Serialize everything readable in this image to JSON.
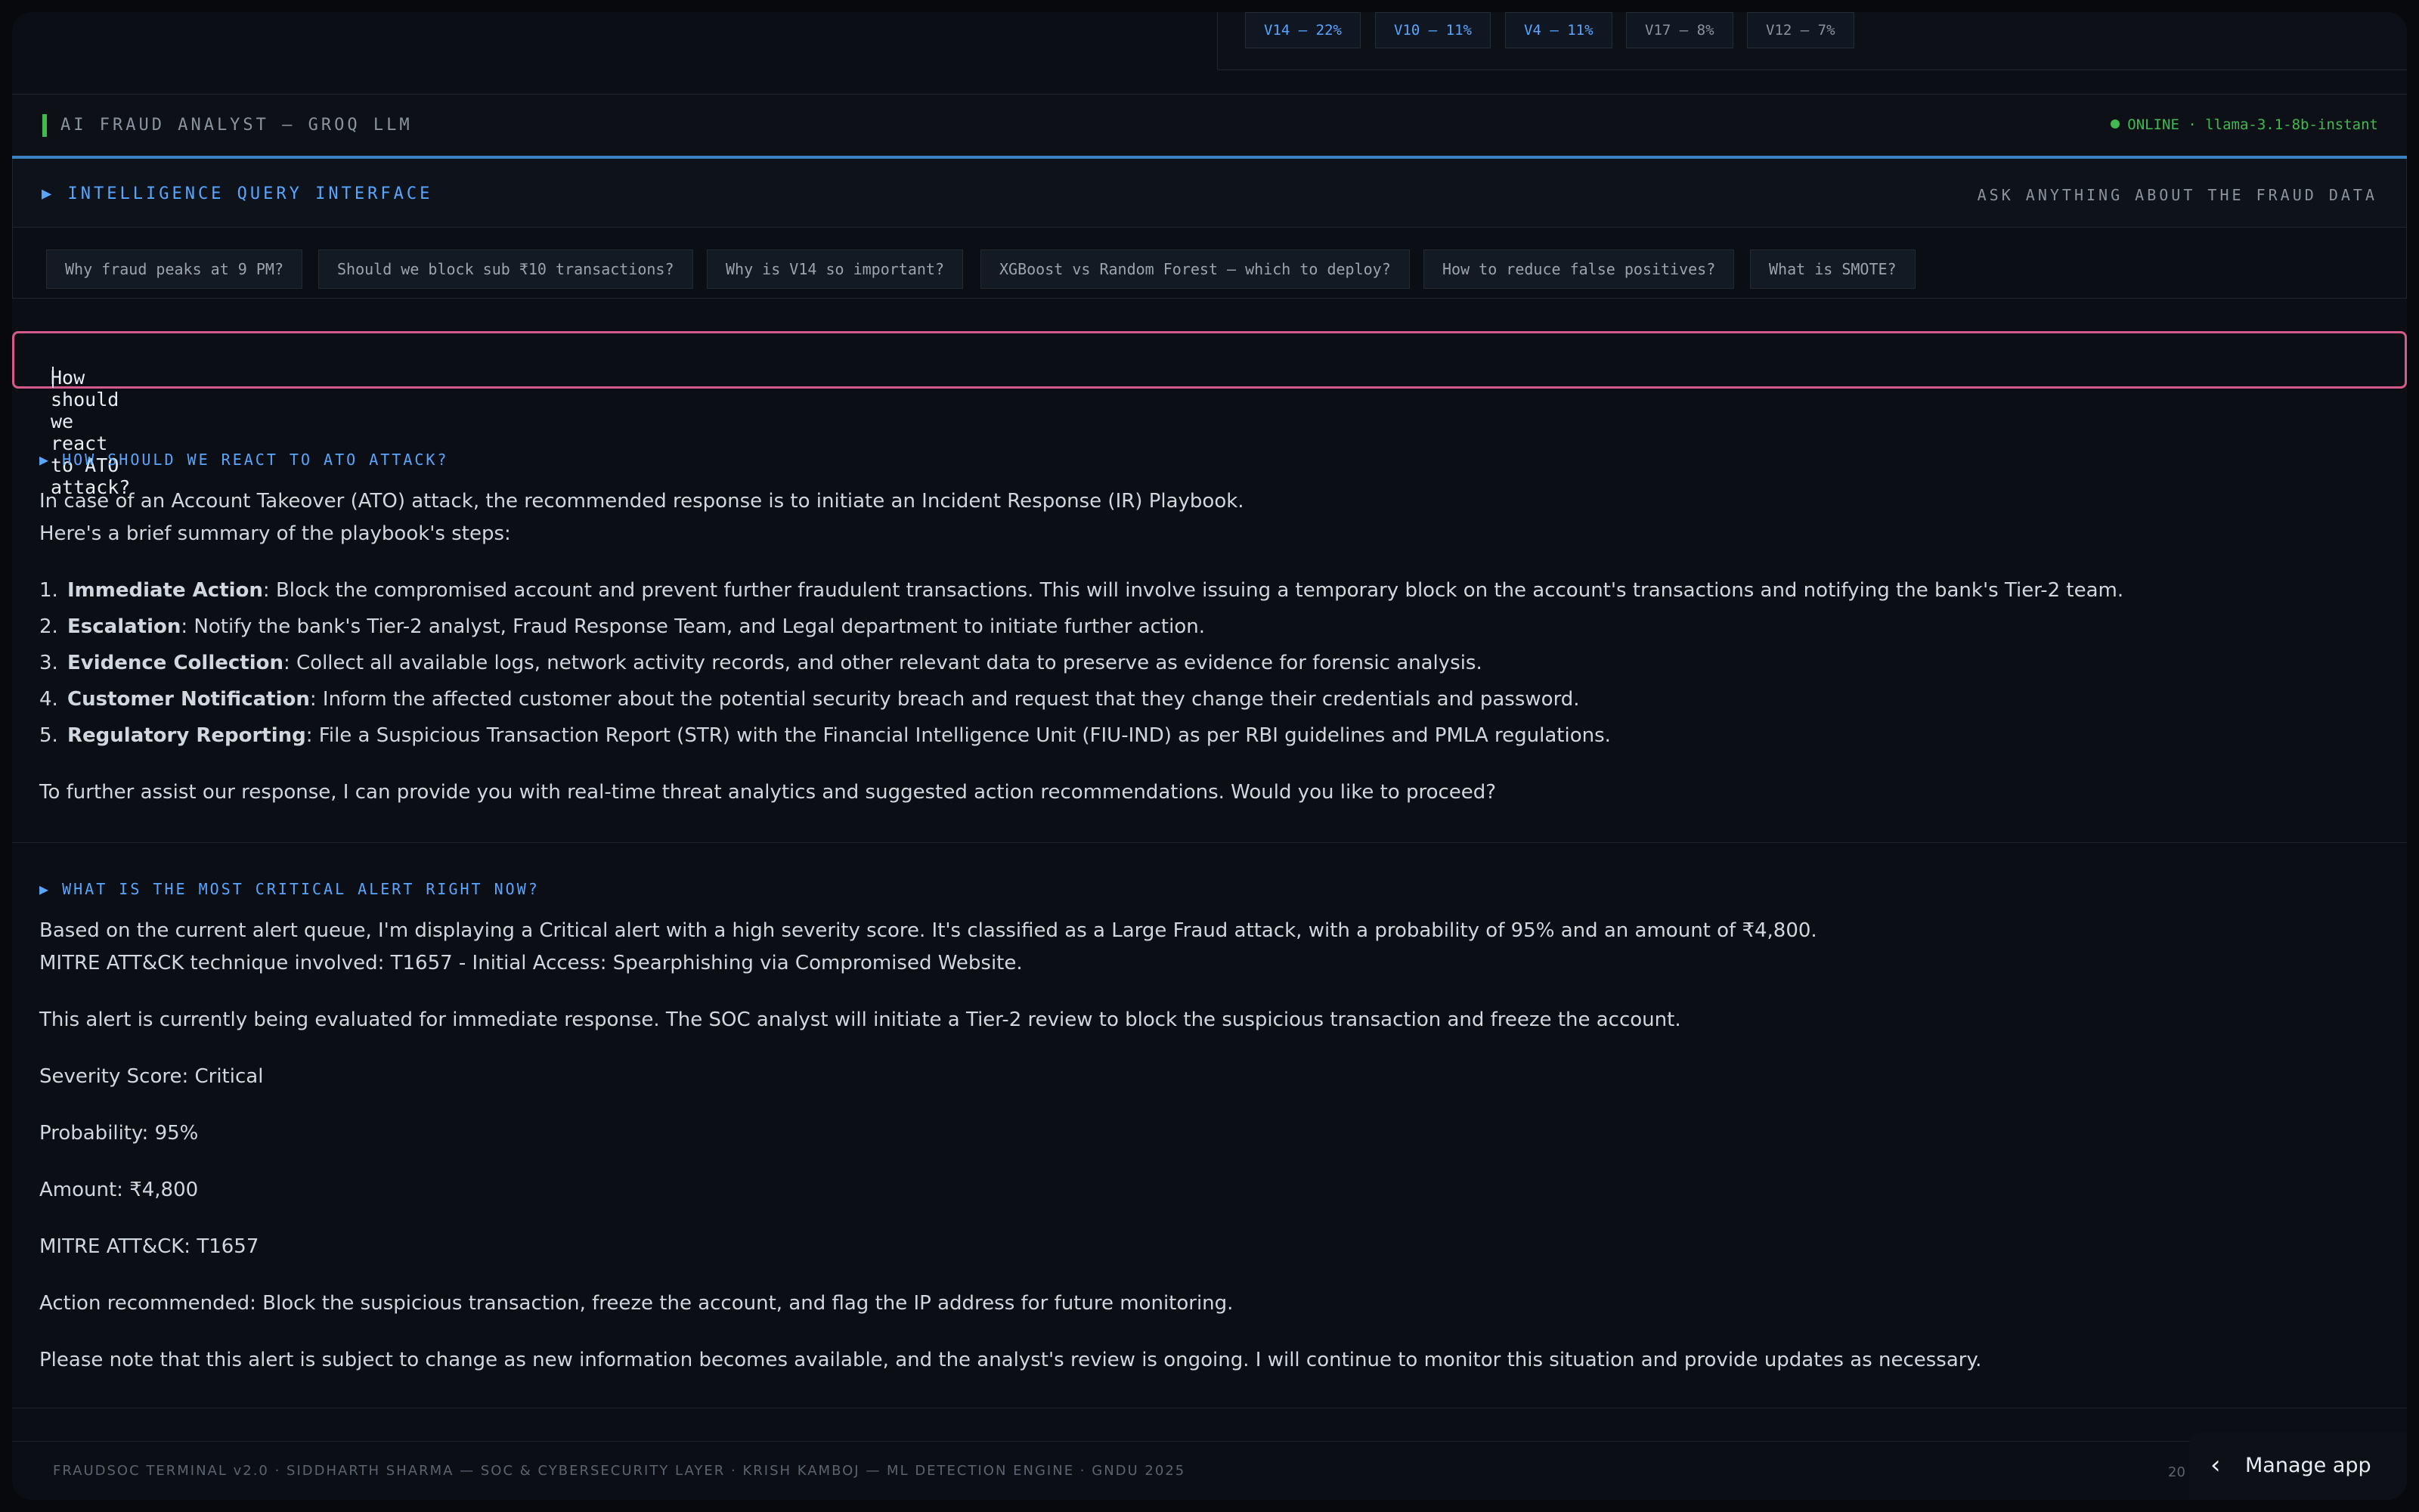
{
  "features": [
    {
      "label": "V14 — 22%"
    },
    {
      "label": "V10 — 11%"
    },
    {
      "label": "V4 — 11%"
    },
    {
      "label": "V17 — 8%"
    },
    {
      "label": "V12 — 7%"
    }
  ],
  "ai_header": {
    "title": "AI FRAUD ANALYST — GROQ LLM",
    "status": "ONLINE · llama-3.1-8b-instant",
    "status_color": "#3fb950"
  },
  "query_interface": {
    "title": "▶ INTELLIGENCE QUERY INTERFACE",
    "hint": "ASK ANYTHING ABOUT THE FRAUD DATA",
    "suggestions": [
      "Why fraud peaks at 9 PM?",
      "Should we block sub ₹10 transactions?",
      "Why is V14 so important?",
      "XGBoost vs Random Forest — which to deploy?",
      "How to reduce false positives?",
      "What is SMOTE?"
    ]
  },
  "input": {
    "value": "How should we react to ATO attack?",
    "border_color": "#d45a8e"
  },
  "qa1": {
    "question": "▶ HOW SHOULD WE REACT TO ATO ATTACK?",
    "intro1": "In case of an Account Takeover (ATO) attack, the recommended response is to initiate an Incident Response (IR) Playbook.",
    "intro2": "Here's a brief summary of the playbook's steps:",
    "steps": [
      {
        "num": "1.",
        "term": "Immediate Action",
        "text": ": Block the compromised account and prevent further fraudulent transactions. This will involve issuing a temporary block on the account's transactions and notifying the bank's Tier-2 team."
      },
      {
        "num": "2.",
        "term": "Escalation",
        "text": ": Notify the bank's Tier-2 analyst, Fraud Response Team, and Legal department to initiate further action."
      },
      {
        "num": "3.",
        "term": "Evidence Collection",
        "text": ": Collect all available logs, network activity records, and other relevant data to preserve as evidence for forensic analysis."
      },
      {
        "num": "4.",
        "term": "Customer Notification",
        "text": ": Inform the affected customer about the potential security breach and request that they change their credentials and password."
      },
      {
        "num": "5.",
        "term": "Regulatory Reporting",
        "text": ": File a Suspicious Transaction Report (STR) with the Financial Intelligence Unit (FIU-IND) as per RBI guidelines and PMLA regulations."
      }
    ],
    "outro": "To further assist our response, I can provide you with real-time threat analytics and suggested action recommendations. Would you like to proceed?"
  },
  "qa2": {
    "question": "▶ WHAT IS THE MOST CRITICAL ALERT RIGHT NOW?",
    "lines": [
      "Based on the current alert queue, I'm displaying a Critical alert with a high severity score. It's classified as a Large Fraud attack, with a probability of 95% and an amount of ₹4,800.",
      "MITRE ATT&CK technique involved: T1657 - Initial Access: Spearphishing via Compromised Website.",
      "This alert is currently being evaluated for immediate response. The SOC analyst will initiate a Tier-2 review to block the suspicious transaction and freeze the account.",
      "Severity Score: Critical",
      "Probability: 95%",
      "Amount: ₹4,800",
      "MITRE ATT&CK: T1657",
      "Action recommended: Block the suspicious transaction, freeze the account, and flag the IP address for future monitoring.",
      "Please note that this alert is subject to change as new information becomes available, and the analyst's review is ongoing. I will continue to monitor this situation and provide updates as necessary."
    ]
  },
  "footer": {
    "text": "FRAUDSOC TERMINAL v2.0 · SIDDHARTH SHARMA — SOC & CYBERSECURITY LAYER · KRISH KAMBOJ — ML DETECTION ENGINE · GNDU 2025",
    "right": "20"
  },
  "manage_app": {
    "icon": "chevron-left-icon",
    "label": "Manage app"
  }
}
